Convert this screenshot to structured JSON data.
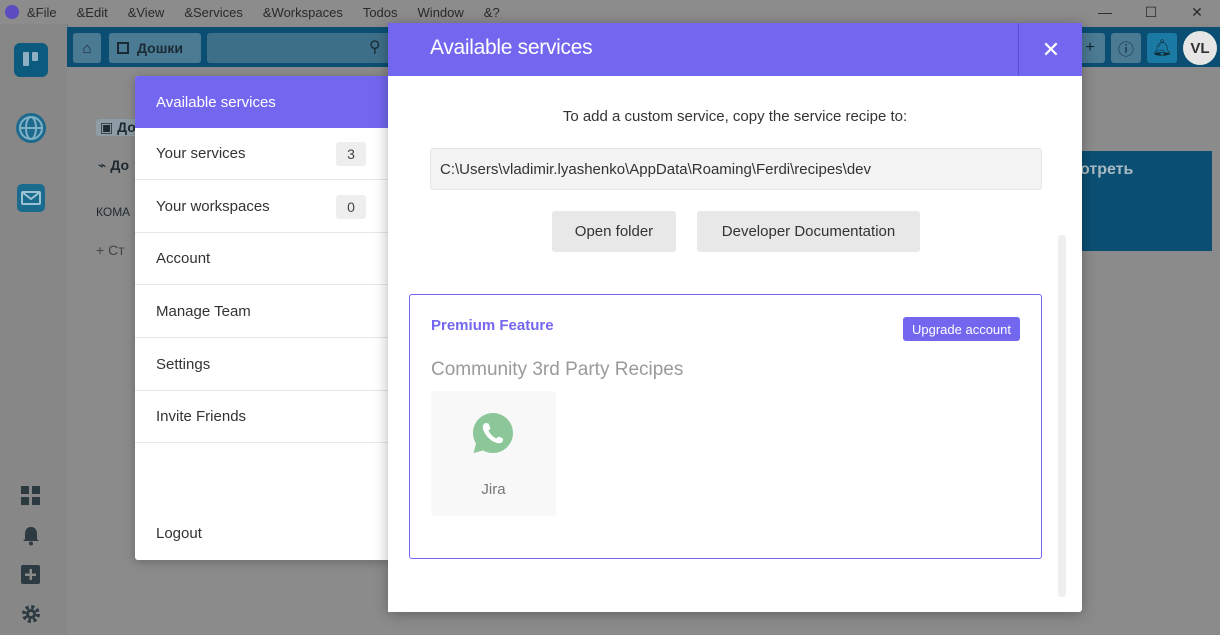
{
  "menubar": {
    "items": [
      "&File",
      "&Edit",
      "&View",
      "&Services",
      "&Workspaces",
      "Todos",
      "Window",
      "&?"
    ]
  },
  "window_controls": {
    "minimize": "—",
    "maximize": "☐",
    "close": "✕"
  },
  "background_app": {
    "header_button": "Дошки",
    "sidebar_label_1": "До",
    "sidebar_label_2": "До",
    "section_label": "КОМА",
    "create_label": "Ст",
    "card_text": "отреть",
    "avatar_initials": "VL"
  },
  "settings_nav": {
    "items": [
      {
        "label": "Available services"
      },
      {
        "label": "Your services",
        "badge": "3"
      },
      {
        "label": "Your workspaces",
        "badge": "0"
      },
      {
        "label": "Account"
      },
      {
        "label": "Manage Team"
      },
      {
        "label": "Settings"
      },
      {
        "label": "Invite Friends"
      }
    ],
    "logout": "Logout"
  },
  "modal": {
    "title": "Available services",
    "close": "✕",
    "hint": "To add a custom service, copy the service recipe to:",
    "recipe_path": "C:\\Users\\vladimir.lyashenko\\AppData\\Roaming\\Ferdi\\recipes\\dev",
    "open_folder": "Open folder",
    "dev_docs": "Developer Documentation",
    "premium": {
      "title": "Premium Feature",
      "upgrade": "Upgrade account",
      "community_title": "Community 3rd Party Recipes",
      "recipes": [
        {
          "name": "Jira",
          "icon": "whatsapp-icon"
        }
      ]
    }
  },
  "colors": {
    "accent": "#7367f0",
    "whatsapp": "#8cc79a",
    "trello_blue": "#0a4f73"
  }
}
